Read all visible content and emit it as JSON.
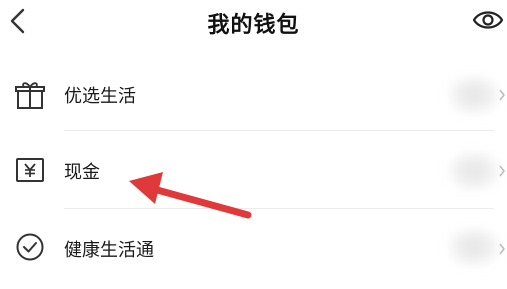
{
  "header": {
    "title": "我的钱包",
    "back_icon": "chevron-left-icon",
    "eye_icon": "eye-icon"
  },
  "rows": [
    {
      "label": "优选生活",
      "icon": "gift-icon"
    },
    {
      "label": "现金",
      "icon": "yuan-card-icon"
    },
    {
      "label": "健康生活通",
      "icon": "check-circle-icon"
    }
  ],
  "annotation": {
    "arrow_color": "#e0393a"
  },
  "colors": {
    "icon": "#333333",
    "text": "#1a1a1a",
    "divider": "#ececec"
  }
}
